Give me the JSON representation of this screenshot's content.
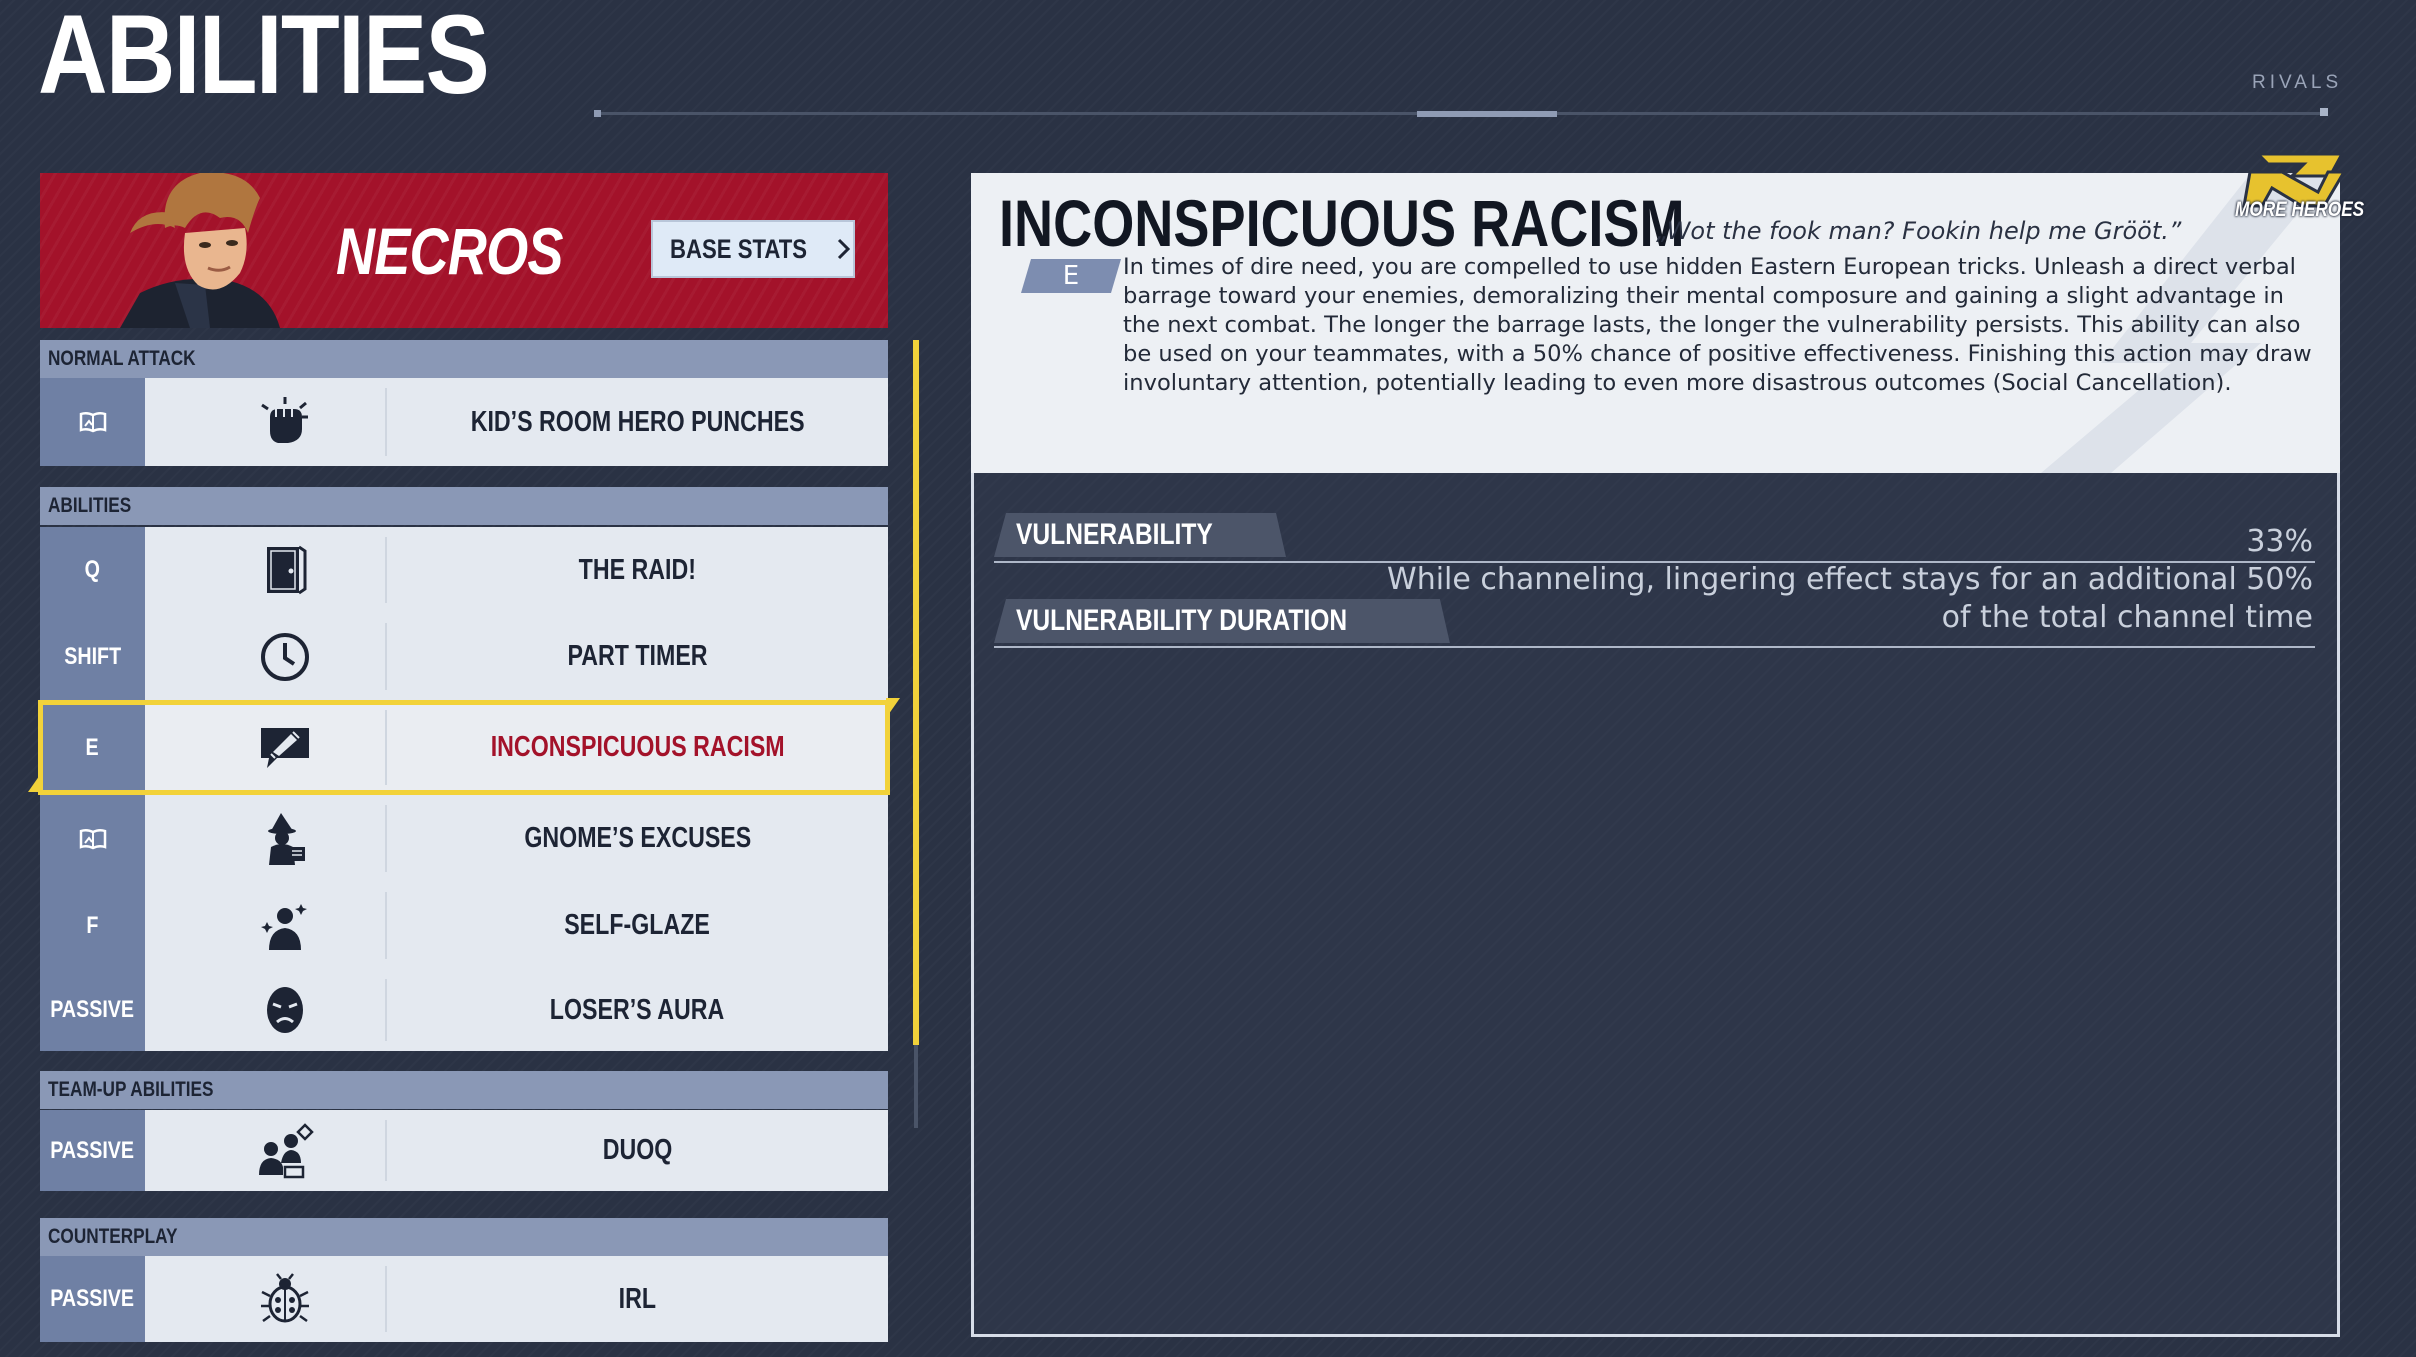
{
  "header": {
    "title": "ABILITIES",
    "brand": "RIVALS"
  },
  "hero": {
    "name": "NECROS",
    "base_stats_label": "BASE STATS"
  },
  "sections": {
    "normal_attack": "NORMAL ATTACK",
    "abilities": "ABILITIES",
    "team_up": "TEAM-UP ABILITIES",
    "counterplay": "COUNTERPLAY"
  },
  "rows": {
    "normal_attack": {
      "key": "",
      "name": "KID’S ROOM HERO PUNCHES",
      "icon": "fist-icon"
    },
    "raid": {
      "key": "Q",
      "name": "THE RAID!",
      "icon": "door-icon"
    },
    "part_timer": {
      "key": "SHIFT",
      "name": "PART TIMER",
      "icon": "clock-icon"
    },
    "racism": {
      "key": "E",
      "name": "INCONSPICUOUS RACISM",
      "icon": "speech-pencil-icon"
    },
    "gnome": {
      "key": "",
      "name": "GNOME’S EXCUSES",
      "icon": "gnome-icon"
    },
    "self_glaze": {
      "key": "F",
      "name": "SELF-GLAZE",
      "icon": "sparkle-person-icon"
    },
    "loser_aura": {
      "key": "PASSIVE",
      "name": "LOSER’S AURA",
      "icon": "sad-mask-icon"
    },
    "duoq": {
      "key": "PASSIVE",
      "name": "DUOQ",
      "icon": "duo-icon"
    },
    "irl": {
      "key": "PASSIVE",
      "name": "IRL",
      "icon": "bug-icon"
    }
  },
  "detail": {
    "title": "INCONSPICUOUS RACISM",
    "quote": "„Wot the fook man? Fookin help me Grööt.”",
    "key": "E",
    "description": "In times of dire need, you are compelled to use hidden Eastern European tricks. Unleash a direct verbal barrage toward your enemies, demoralizing their mental composure and gaining a slight advantage in the next combat. The longer the barrage lasts, the longer the vulnerability persists. This ability can also be used on your teammates, with a 50% chance of positive effectiveness. Finishing this action may draw involuntary attention, potentially leading to even more disastrous outcomes (Social Cancellation)."
  },
  "stats": [
    {
      "label": "VULNERABILITY",
      "value": "33%"
    },
    {
      "label": "VULNERABILITY DURATION",
      "value_line1": "While channeling, lingering effect stays for an additional 50%",
      "value_line2": "of the total channel time"
    }
  ],
  "more_heroes_label": "MORE HEROES",
  "colors": {
    "accent_red": "#a3122a",
    "highlight_yellow": "#f2d23a",
    "key_blue": "#6f80a4"
  }
}
